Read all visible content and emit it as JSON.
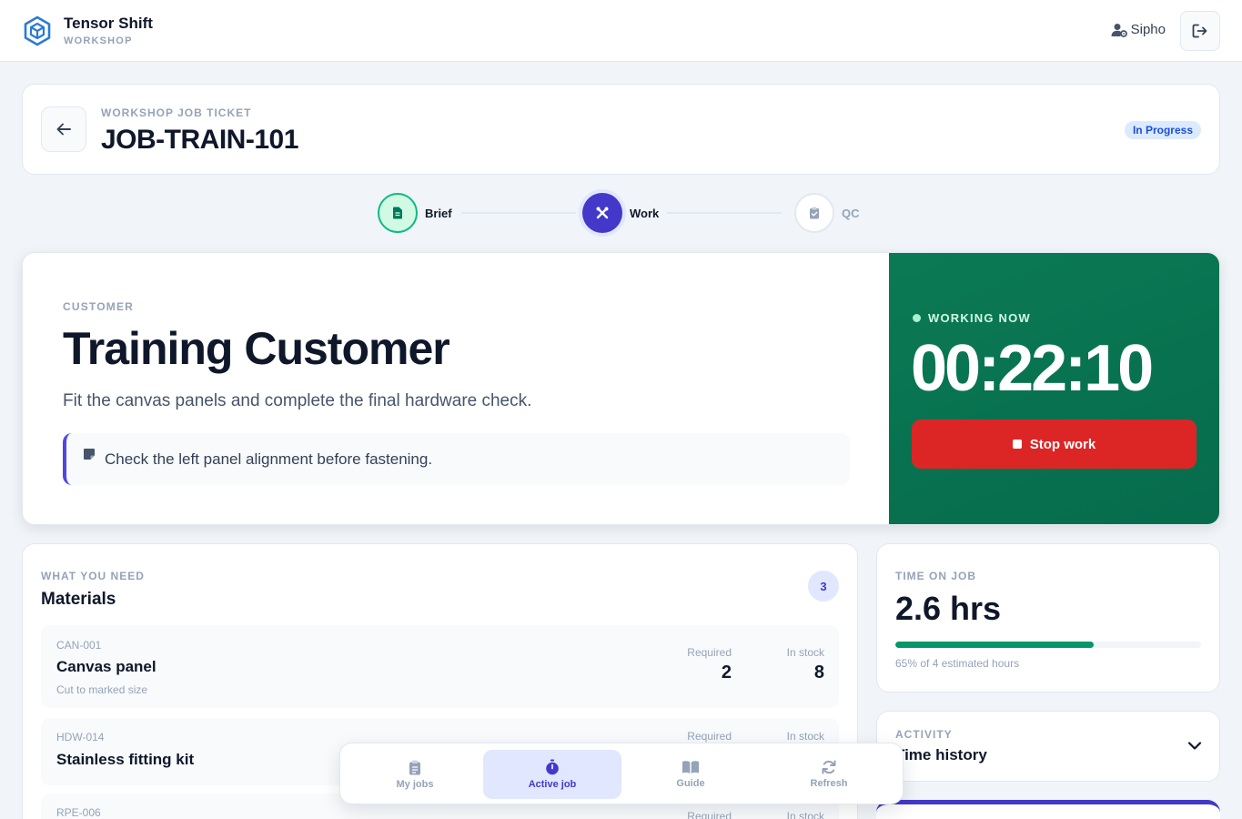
{
  "header": {
    "brand_name": "Tensor Shift",
    "brand_sub": "WORKSHOP",
    "user_name": "Sipho"
  },
  "ticket": {
    "eyebrow": "WORKSHOP JOB TICKET",
    "id": "JOB-TRAIN-101",
    "status": "In Progress"
  },
  "stepper": {
    "steps": [
      {
        "label": "Brief",
        "state": "done",
        "icon": "document-icon"
      },
      {
        "label": "Work",
        "state": "current",
        "icon": "tools-icon"
      },
      {
        "label": "QC",
        "state": "pending",
        "icon": "clipboard-check-icon"
      }
    ]
  },
  "customer": {
    "eyebrow": "CUSTOMER",
    "name": "Training Customer",
    "description": "Fit the canvas panels and complete the final hardware check.",
    "note": "Check the left panel alignment before fastening."
  },
  "timer": {
    "label": "WORKING NOW",
    "value": "00:22:10",
    "stop_label": "Stop work"
  },
  "materials": {
    "eyebrow": "WHAT YOU NEED",
    "title": "Materials",
    "count": "3",
    "required_label": "Required",
    "stock_label": "In stock",
    "items": [
      {
        "code": "CAN-001",
        "name": "Canvas panel",
        "note": "Cut to marked size",
        "required": "2",
        "in_stock": "8"
      },
      {
        "code": "HDW-014",
        "name": "Stainless fitting kit",
        "note": "",
        "required": "",
        "in_stock": ""
      },
      {
        "code": "RPE-006",
        "name": "",
        "note": "",
        "required": "",
        "in_stock": ""
      }
    ]
  },
  "time_on_job": {
    "eyebrow": "TIME ON JOB",
    "value": "2.6 hrs",
    "progress_percent": 65,
    "caption": "65% of 4 estimated hours"
  },
  "activity": {
    "eyebrow": "ACTIVITY",
    "title": "Time history"
  },
  "bottom_nav": {
    "items": [
      {
        "label": "My jobs",
        "icon": "clipboard-icon",
        "active": false
      },
      {
        "label": "Active job",
        "icon": "stopwatch-icon",
        "active": true
      },
      {
        "label": "Guide",
        "icon": "book-icon",
        "active": false
      },
      {
        "label": "Refresh",
        "icon": "refresh-icon",
        "active": false
      }
    ]
  },
  "colors": {
    "accent": "#4338ca",
    "timer_bg": "#0b7a54",
    "stop": "#dc2626",
    "progress": "#059669",
    "done_step": "#10b981"
  }
}
